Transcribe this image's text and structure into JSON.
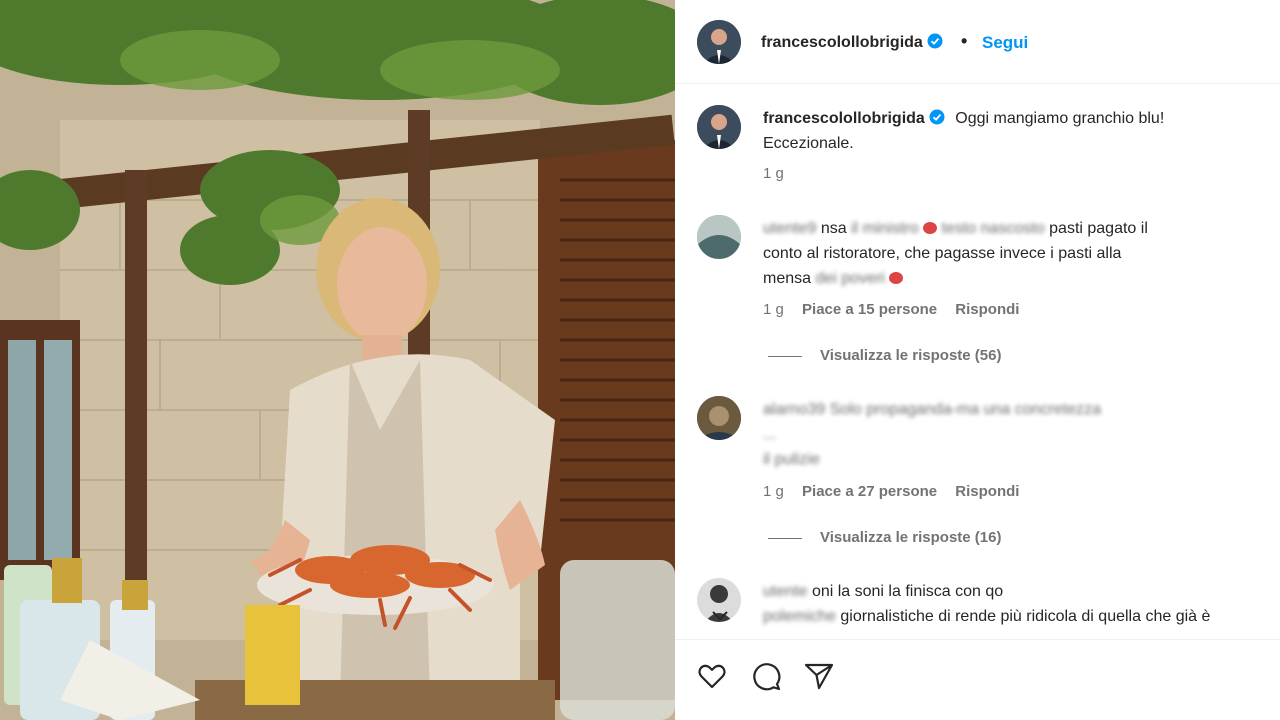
{
  "post": {
    "author": "francescolollobrigida",
    "follow_label": "Segui",
    "separator": "•"
  },
  "caption": {
    "author": "francescolollobrigida",
    "text": "Oggi mangiamo granchio blu!",
    "text_line2": "Eccezionale.",
    "time": "1 g"
  },
  "comments": [
    {
      "line1_a": "nsa",
      "line1_b": "pasti pagato il",
      "line2": "conto al ristoratore, che pagasse invece i pasti alla",
      "line3": "mensa",
      "time": "1 g",
      "likes": "Piace a 15 persone",
      "reply": "Rispondi",
      "view_replies": "Visualizza le risposte (56)"
    },
    {
      "line1": "alarno39 Solo propaganda-ma una concretezza",
      "line2": "...",
      "line3": "il pulizie",
      "time": "1 g",
      "likes": "Piace a 27 persone",
      "reply": "Rispondi",
      "view_replies": "Visualizza le risposte (16)"
    },
    {
      "line1": "oni la soni la finisca con qo",
      "line2": "giornalistiche di rende più ridicola di quella che già è"
    }
  ],
  "icons": [
    "verified-icon",
    "heart-icon",
    "comment-icon",
    "share-icon",
    "chevron-down-icon"
  ],
  "colors": {
    "accent": "#0095f6",
    "text": "#262626",
    "muted": "#737373",
    "border": "#efefef"
  }
}
